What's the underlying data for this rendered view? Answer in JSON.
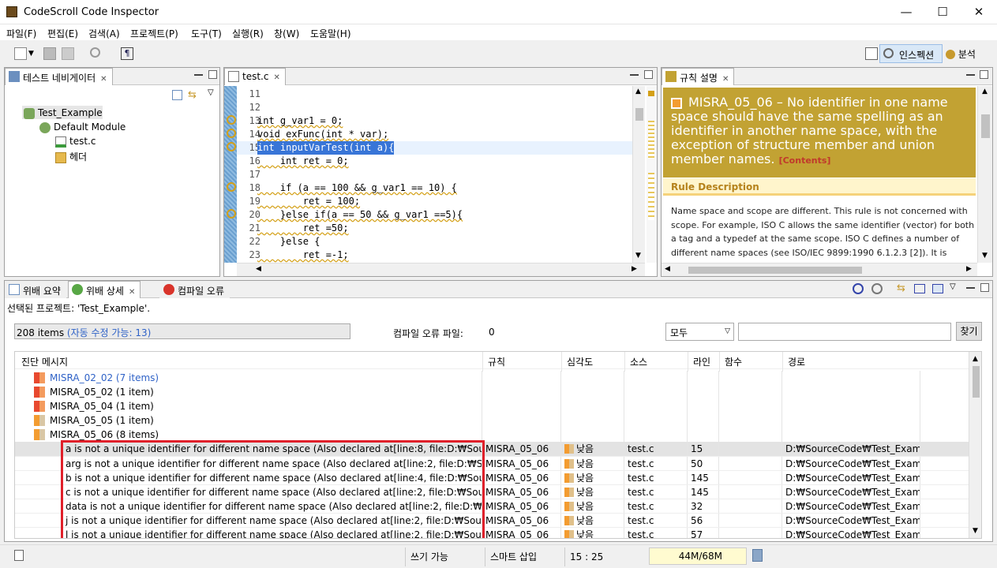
{
  "window": {
    "title": "CodeScroll Code Inspector",
    "minimize": "—",
    "maximize": "☐",
    "close": "✕"
  },
  "menu": [
    "파일(F)",
    "편집(E)",
    "검색(A)",
    "프로젝트(P)",
    "도구(T)",
    "실행(R)",
    "창(W)",
    "도움말(H)"
  ],
  "perspectives": {
    "inspection": "인스펙션",
    "analysis": "분석"
  },
  "navigator": {
    "tab": "테스트 네비게이터",
    "tree": [
      {
        "label": "Test_Example",
        "level": 0
      },
      {
        "label": "Default Module",
        "level": 1
      },
      {
        "label": "test.c",
        "level": 2
      },
      {
        "label": "헤더",
        "level": 2
      }
    ]
  },
  "editor": {
    "tab": "test.c",
    "lines": [
      {
        "n": "11",
        "code": ""
      },
      {
        "n": "12",
        "code": ""
      },
      {
        "n": "13",
        "code": "int g_var1 = 0;"
      },
      {
        "n": "14",
        "code": "void exFunc(int * var);"
      },
      {
        "n": "15",
        "code": "int inputVarTest(int a){"
      },
      {
        "n": "16",
        "code": "    int ret = 0;"
      },
      {
        "n": "17",
        "code": ""
      },
      {
        "n": "18",
        "code": "    if (a == 100 && g_var1 == 10) {"
      },
      {
        "n": "19",
        "code": "        ret = 100;"
      },
      {
        "n": "20",
        "code": "    }else if(a == 50 && g_var1 ==5){"
      },
      {
        "n": "21",
        "code": "        ret =50;"
      },
      {
        "n": "22",
        "code": "    }else {"
      },
      {
        "n": "23",
        "code": "        ret =-1;"
      }
    ]
  },
  "rule": {
    "tab": "규칙 설명",
    "title": "MISRA_05_06 – No identifier in one name space should have the same spelling as an identifier in another name space, with the exception of structure member and union member names.",
    "contents_link": "[Contents]",
    "section": "Rule Description",
    "body": "Name space and scope are different. This rule is not concerned with scope. For example, ISO C allows the same identifier (vector) for both a tag and a typedef at the same scope. ISO C defines a number of different name spaces (see ISO/IEC 9899:1990 6.1.2.3 [2]). It is"
  },
  "bottom": {
    "tabs": [
      "위배 요약",
      "위배 상세",
      "컴파일 오류"
    ],
    "selected_project": "선택된 프로젝트: 'Test_Example'.",
    "items_count": "208 items",
    "auto_fix": "(자동 수정 가능: 13)",
    "compile_err_label": "컴파일 오류 파일:",
    "compile_err_count": "0",
    "filter_value": "모두",
    "search_placeholder": "",
    "find_button": "찾기",
    "columns": [
      "진단 메시지",
      "규칙",
      "심각도",
      "소스",
      "라인",
      "함수",
      "경로"
    ],
    "groups": [
      {
        "label": "MISRA_02_02 (7 items)",
        "linked": true
      },
      {
        "label": "MISRA_05_02 (1 item)",
        "linked": false
      },
      {
        "label": "MISRA_05_04 (1 item)",
        "linked": false
      },
      {
        "label": "MISRA_05_05 (1 item)",
        "linked": false
      },
      {
        "label": "MISRA_05_06 (8 items)",
        "linked": false
      }
    ],
    "rows": [
      {
        "msg": "a is not a unique identifier for different name space (Also declared  at[line:8, file:D:₩SourceCode₩",
        "rule": "MISRA_05_06",
        "sev": "낮음",
        "src": "test.c",
        "line": "15",
        "func": "",
        "path": "D:₩SourceCode₩Test_Example"
      },
      {
        "msg": "arg is not a unique identifier for different name space (Also declared  at[line:2, file:D:₩SourceCode₩",
        "rule": "MISRA_05_06",
        "sev": "낮음",
        "src": "test.c",
        "line": "50",
        "func": "",
        "path": "D:₩SourceCode₩Test_Example"
      },
      {
        "msg": "b is not a unique identifier for different name space (Also declared  at[line:4, file:D:₩SourceCode₩",
        "rule": "MISRA_05_06",
        "sev": "낮음",
        "src": "test.c",
        "line": "145",
        "func": "",
        "path": "D:₩SourceCode₩Test_Example"
      },
      {
        "msg": "c is not a unique identifier for different name space (Also declared  at[line:2, file:D:₩SourceCode₩",
        "rule": "MISRA_05_06",
        "sev": "낮음",
        "src": "test.c",
        "line": "145",
        "func": "",
        "path": "D:₩SourceCode₩Test_Example"
      },
      {
        "msg": "data is not a unique identifier for different name space (Also declared  at[line:2, file:D:₩SourceCo",
        "rule": "MISRA_05_06",
        "sev": "낮음",
        "src": "test.c",
        "line": "32",
        "func": "",
        "path": "D:₩SourceCode₩Test_Example"
      },
      {
        "msg": "j is not a unique identifier for different name space (Also declared  at[line:2, file:D:₩SourceCode₩",
        "rule": "MISRA_05_06",
        "sev": "낮음",
        "src": "test.c",
        "line": "56",
        "func": "",
        "path": "D:₩SourceCode₩Test_Example"
      },
      {
        "msg": "l is not a unique identifier for different name space (Also declared  at[line:2, file:D:₩SourceCode₩",
        "rule": "MISRA_05_06",
        "sev": "낮음",
        "src": "test.c",
        "line": "57",
        "func": "",
        "path": "D:₩SourceCode₩Test_Example"
      }
    ]
  },
  "status": {
    "writable": "쓰기 가능",
    "insert": "스마트 삽입",
    "position": "15 : 25",
    "memory": "44M/68M"
  },
  "colors": {
    "accent": "#3875d7",
    "rule_header": "#c2a233",
    "highlight_box": "#e0202a"
  }
}
